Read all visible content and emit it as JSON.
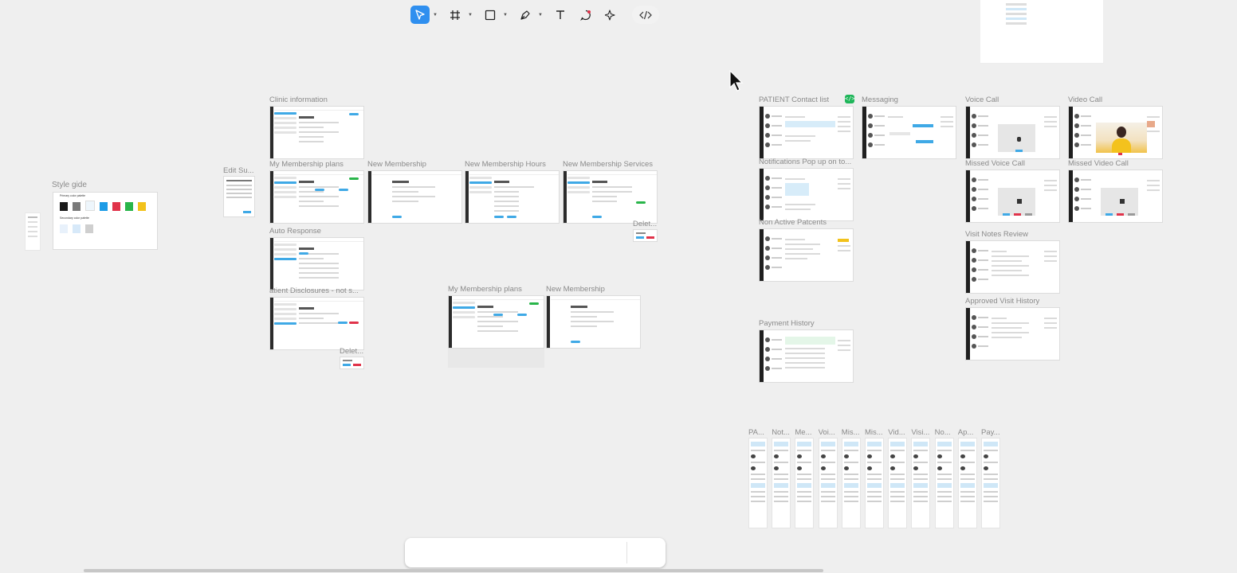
{
  "labels": {
    "clinic_information": "Clinic information",
    "edit_su": "Edit Su...",
    "style_gide": "Style gide",
    "my_membership_plans": "My Membership plans",
    "new_membership": "New Membership",
    "new_membership_hours": "New Membership Hours",
    "new_membership_services": "New Membership Services",
    "delet_1": "Delet...",
    "auto_response": "Auto Response",
    "patient_disclosures": "atient Disclosures - not s...",
    "delet_2": "Delet...",
    "my_membership_plans_2": "My Membership plans",
    "new_membership_2": "New Membership",
    "patient_contact_list": "PATIENT Contact list",
    "messaging": "Messaging",
    "voice_call": "Voice Call",
    "video_call": "Video Call",
    "notifications_popup": "Notifications Pop up on to...",
    "missed_voice_call": "Missed Voice Call",
    "missed_video_call": "Missed Video Call",
    "non_active_patients": "Non Active Patcents",
    "visit_notes_review": "Visit Notes Review",
    "approved_visit_history": "Approved Visit History",
    "payment_history": "Payment History"
  },
  "mini_labels": [
    "PA...",
    "Not...",
    "Me...",
    "Voi...",
    "Mis...",
    "Mis...",
    "Vid...",
    "Visi...",
    "No...",
    "Ap...",
    "Pay..."
  ],
  "style_guide": {
    "primary_title": "Primary color palette",
    "secondary_title": "Secondary color palette",
    "primary_colors": [
      "#1a1a1a",
      "#7a7a7a",
      "#eef6fc",
      "#1c9be6",
      "#e0334a",
      "#29b54a",
      "#f2c21b"
    ],
    "secondary_colors": [
      "#e8f1fb",
      "#d7e9f9",
      "#cfcfcf"
    ]
  },
  "toolbar": {
    "tools": [
      "move-tool",
      "frame-tool",
      "shape-tool",
      "pen-tool",
      "text-tool",
      "comment-tool",
      "ai-tool",
      "dev-mode-toggle"
    ]
  },
  "badge": "</>"
}
